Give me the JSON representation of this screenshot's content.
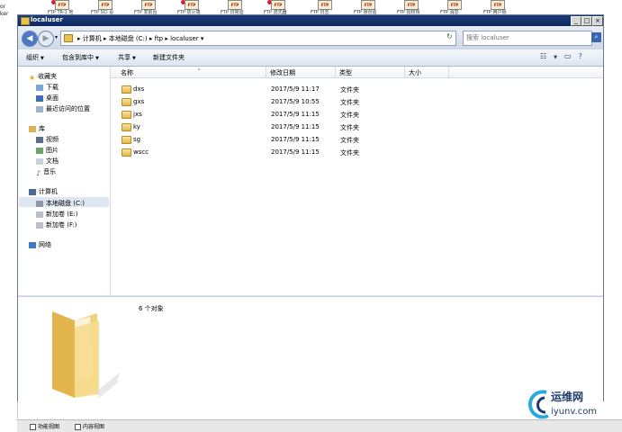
{
  "left_strip": {
    "lines": [
      "or",
      "ker"
    ]
  },
  "top_icons": [
    {
      "label": "FTP TR-1 地"
    },
    {
      "label": "FTP SCI 设"
    },
    {
      "label": "FTP 发前台"
    },
    {
      "label": "FTP 防火墙"
    },
    {
      "label": "FTP 日常运"
    },
    {
      "label": "FTP 流式器"
    },
    {
      "label": "FTP 日志"
    },
    {
      "label": "FTP 身份验"
    },
    {
      "label": "FTP 授权规"
    },
    {
      "label": "FTP 消息"
    },
    {
      "label": "FTP 用户隔"
    }
  ],
  "window": {
    "title": "localuser",
    "controls": {
      "minimize": "_",
      "maximize": "□",
      "close": "×"
    }
  },
  "address": {
    "back": "◀",
    "forward": "▶",
    "dropdown": "▾",
    "crumbs": "▸ 计算机 ▸ 本地磁盘 (C:) ▸ ftp ▸ localuser ▾",
    "refresh": "↻",
    "search_placeholder": "搜索 localuser"
  },
  "toolbar": {
    "organize": "组织",
    "include_in_library": "包含到库中",
    "share": "共享",
    "new_folder": "新建文件夹"
  },
  "nav": {
    "favorites": "收藏夹",
    "downloads": "下载",
    "desktop": "桌面",
    "recent": "最近访问的位置",
    "libraries": "库",
    "videos": "视频",
    "pictures": "图片",
    "documents": "文档",
    "music": "音乐",
    "computer": "计算机",
    "local_disk_c": "本地磁盘 (C:)",
    "new_volume_e": "新加卷 (E:)",
    "new_volume_f": "新加卷 (F:)",
    "network": "网络"
  },
  "columns": {
    "name": "名称",
    "modified": "修改日期",
    "type": "类型",
    "size": "大小"
  },
  "files": [
    {
      "name": "dxs",
      "modified": "2017/5/9 11:17",
      "type": "文件夹"
    },
    {
      "name": "gxs",
      "modified": "2017/5/9 10:55",
      "type": "文件夹"
    },
    {
      "name": "jxs",
      "modified": "2017/5/9 11:15",
      "type": "文件夹"
    },
    {
      "name": "ky",
      "modified": "2017/5/9 11:15",
      "type": "文件夹"
    },
    {
      "name": "sg",
      "modified": "2017/5/9 11:15",
      "type": "文件夹"
    },
    {
      "name": "wscc",
      "modified": "2017/5/9 11:15",
      "type": "文件夹"
    }
  ],
  "details": {
    "object_count": "6 个对象"
  },
  "taskbar": {
    "item1": "功能视图",
    "item2": "内容视图"
  },
  "watermark": {
    "name": "运维网",
    "url": "iyunv.com"
  },
  "colors": {
    "title_bar": "#0b2864",
    "folder": "#e3b94d",
    "selection": "#dde6f1"
  }
}
